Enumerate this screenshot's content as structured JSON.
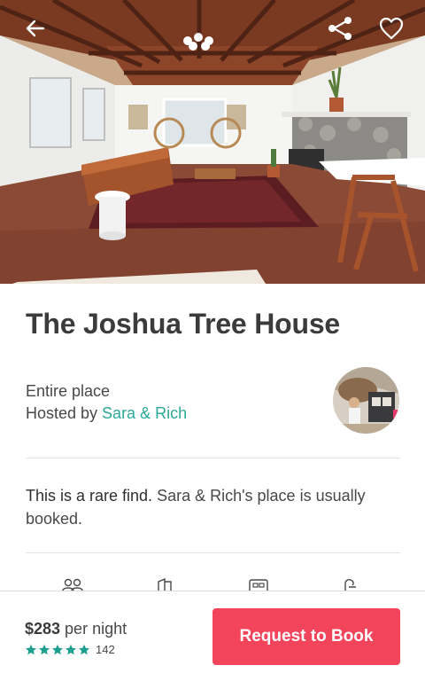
{
  "listing": {
    "title": "The Joshua Tree House",
    "place_type": "Entire place",
    "hosted_prefix": "Hosted by ",
    "host_name": "Sara & Rich",
    "rarity_strong": "This is a rare find.",
    "rarity_rest": " Sara & Rich's place is usually booked."
  },
  "hero_actions": {
    "back_icon": "back-arrow-icon",
    "share_icon": "share-icon",
    "favorite_icon": "heart-icon"
  },
  "amenities": [
    {
      "icon": "guests-icon"
    },
    {
      "icon": "bedrooms-icon"
    },
    {
      "icon": "beds-icon"
    },
    {
      "icon": "baths-icon"
    }
  ],
  "booking": {
    "price": "$283",
    "per_night": " per night",
    "rating_stars": 5,
    "review_count": "142",
    "button_label": "Request to Book"
  },
  "colors": {
    "accent": "#f2445a",
    "link": "#2ba896",
    "star": "#1fa08e"
  }
}
